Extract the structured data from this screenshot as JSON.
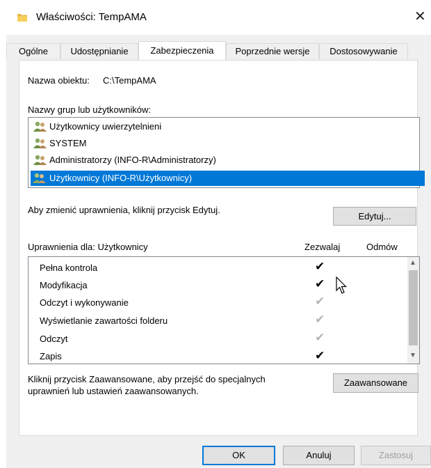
{
  "window": {
    "title": "Właściwości: TempAMA",
    "close_glyph": "✕"
  },
  "tabs": [
    {
      "label": "Ogólne"
    },
    {
      "label": "Udostępnianie"
    },
    {
      "label": "Zabezpieczenia",
      "active": true
    },
    {
      "label": "Poprzednie wersje"
    },
    {
      "label": "Dostosowywanie"
    }
  ],
  "security": {
    "object_name_label": "Nazwa obiektu:",
    "object_name_value": "C:\\TempAMA",
    "groups_label": "Nazwy grup lub użytkowników:",
    "groups": [
      {
        "label": "Użytkownicy uwierzytelnieni",
        "selected": false
      },
      {
        "label": "SYSTEM",
        "selected": false
      },
      {
        "label": "Administratorzy (INFO-R\\Administratorzy)",
        "selected": false
      },
      {
        "label": "Użytkownicy (INFO-R\\Użytkownicy)",
        "selected": true
      }
    ],
    "edit_hint": "Aby zmienić uprawnienia, kliknij przycisk Edytuj.",
    "edit_button": "Edytuj...",
    "permissions_for_label": "Uprawnienia dla: Użytkownicy",
    "allow_header": "Zezwalaj",
    "deny_header": "Odmów",
    "permissions": [
      {
        "name": "Pełna kontrola",
        "allow": "✔",
        "inherited": false
      },
      {
        "name": "Modyfikacja",
        "allow": "✔",
        "inherited": false
      },
      {
        "name": "Odczyt i wykonywanie",
        "allow": "✔",
        "inherited": true
      },
      {
        "name": "Wyświetlanie zawartości folderu",
        "allow": "✔",
        "inherited": true
      },
      {
        "name": "Odczyt",
        "allow": "✔",
        "inherited": true
      },
      {
        "name": "Zapis",
        "allow": "✔",
        "inherited": false
      }
    ],
    "advanced_hint_line1": "Kliknij przycisk Zaawansowane, aby przejść do specjalnych",
    "advanced_hint_line2": "uprawnień lub ustawień zaawansowanych.",
    "advanced_button": "Zaawansowane"
  },
  "footer": {
    "ok": "OK",
    "cancel": "Anuluj",
    "apply": "Zastosuj"
  },
  "colors": {
    "selection": "#0078d7",
    "inherited_check": "#b5b5b5"
  }
}
